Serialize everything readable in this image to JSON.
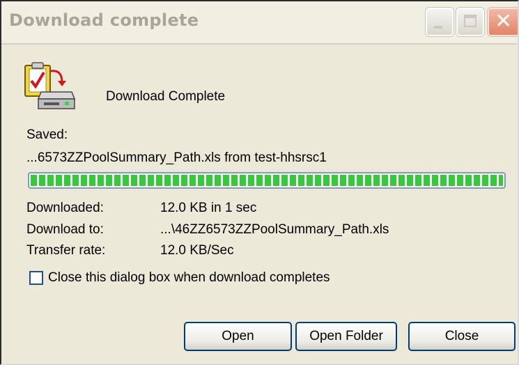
{
  "window": {
    "title": "Download complete"
  },
  "titlebar_buttons": {
    "minimize": "minimize-icon",
    "maximize": "maximize-icon",
    "close": "close-icon"
  },
  "dialog": {
    "heading": "Download Complete",
    "saved_label": "Saved:",
    "saved_file": "...6573ZZPoolSummary_Path.xls from test-hhsrsc1",
    "progress_fraction": 1.0,
    "downloaded_label": "Downloaded:",
    "downloaded_value": "12.0 KB in 1 sec",
    "download_to_label": "Download to:",
    "download_to_value": "...\\46ZZ6573ZZPoolSummary_Path.xls",
    "transfer_rate_label": "Transfer rate:",
    "transfer_rate_value": "12.0 KB/Sec",
    "close_when_complete_label": "Close this dialog box when download completes",
    "close_when_complete_checked": false
  },
  "buttons": {
    "open": "Open",
    "open_folder": "Open Folder",
    "close": "Close"
  },
  "colors": {
    "progress": "#37c93b",
    "button_border": "#003c74",
    "dialog_bg": "#ece9d8"
  }
}
